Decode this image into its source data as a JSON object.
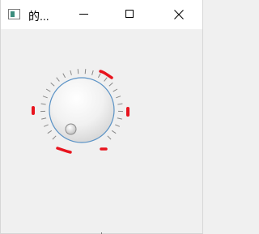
{
  "window": {
    "title": "的...",
    "icon": "app-window-icon",
    "controls": [
      "minimize-icon",
      "maximize-icon",
      "close-icon"
    ]
  },
  "dial": {
    "type": "rotary-knob",
    "indicator_position": "lower-left",
    "colors": {
      "knob_outline": "#5b93c6",
      "notch_ticks": "#888888",
      "annotation_marks": "#e8141e"
    }
  }
}
